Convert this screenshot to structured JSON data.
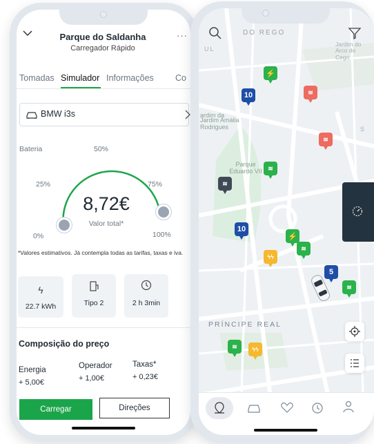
{
  "left": {
    "header": {
      "title": "Parque do Saldanha",
      "subtitle": "Carregador Rápido"
    },
    "tabs": [
      "Tomadas",
      "Simulador",
      "Informações",
      "Co"
    ],
    "active_tab": "Simulador",
    "vehicle": "BMW i3s",
    "gauge": {
      "battery_label": "Bateria",
      "marks": {
        "p0": "0%",
        "p25": "25%",
        "p50": "50%",
        "p75": "75%",
        "p100": "100%"
      },
      "value": "8,72€",
      "caption": "Valor total*",
      "start_fraction": 0.0,
      "end_fraction": 1.0
    },
    "disclaimer": "*Valores estimativos. Já contempla todas as tarifas, taxas e iva.",
    "stats": [
      {
        "icon": "bolt-icon",
        "value": "22.7 kWh"
      },
      {
        "icon": "plug-icon",
        "value": "Tipo 2"
      },
      {
        "icon": "clock-icon",
        "value": "2 h 3min"
      }
    ],
    "price": {
      "title": "Composição do preço",
      "energy_label": "Energia",
      "energy_value": "+ 5,00€",
      "operator_label": "Operador",
      "operator_value": "+ 1,00€",
      "tax_label": "Taxas*",
      "tax_value": "+ 0,23€"
    },
    "actions": {
      "charge": "Carregar",
      "directions": "Direções"
    }
  },
  "right": {
    "map_labels": {
      "do_rego": "DO REGO",
      "jardim_amalia": "Jardim Amália Rodrigues",
      "parque": "Parque Eduardo VII",
      "jardim_arco": "Jardim do Arco do Cego",
      "principe_real": "PRÍNCIPE REAL",
      "jardim_left": "ardim da",
      "ul": "UL",
      "s": "S"
    },
    "pins": [
      {
        "label": "10",
        "color": "#1f4ea8"
      },
      {
        "label": "10",
        "color": "#1f4ea8"
      },
      {
        "label": "5",
        "color": "#1f4ea8"
      },
      {
        "label": "⚡",
        "color": "#2bb24c"
      },
      {
        "label": "⚡",
        "color": "#2bb24c"
      },
      {
        "label": "≋",
        "color": "#2bb24c"
      },
      {
        "label": "≋",
        "color": "#2bb24c"
      },
      {
        "label": "≋",
        "color": "#2bb24c"
      },
      {
        "label": "≋",
        "color": "#2bb24c"
      },
      {
        "label": "≋",
        "color": "#ee6b5f"
      },
      {
        "label": "≋",
        "color": "#ee6b5f"
      },
      {
        "label": "≋",
        "color": "#3f4a56"
      },
      {
        "label": "ϟϟ",
        "color": "#f5b82e"
      },
      {
        "label": "ϟϟ",
        "color": "#f5b82e"
      }
    ],
    "nav": [
      "map-pin-icon",
      "car-icon",
      "heart-icon",
      "history-icon",
      "profile-icon"
    ]
  },
  "colors": {
    "accent_green": "#1ba54a",
    "dark_panel": "#23333f"
  }
}
